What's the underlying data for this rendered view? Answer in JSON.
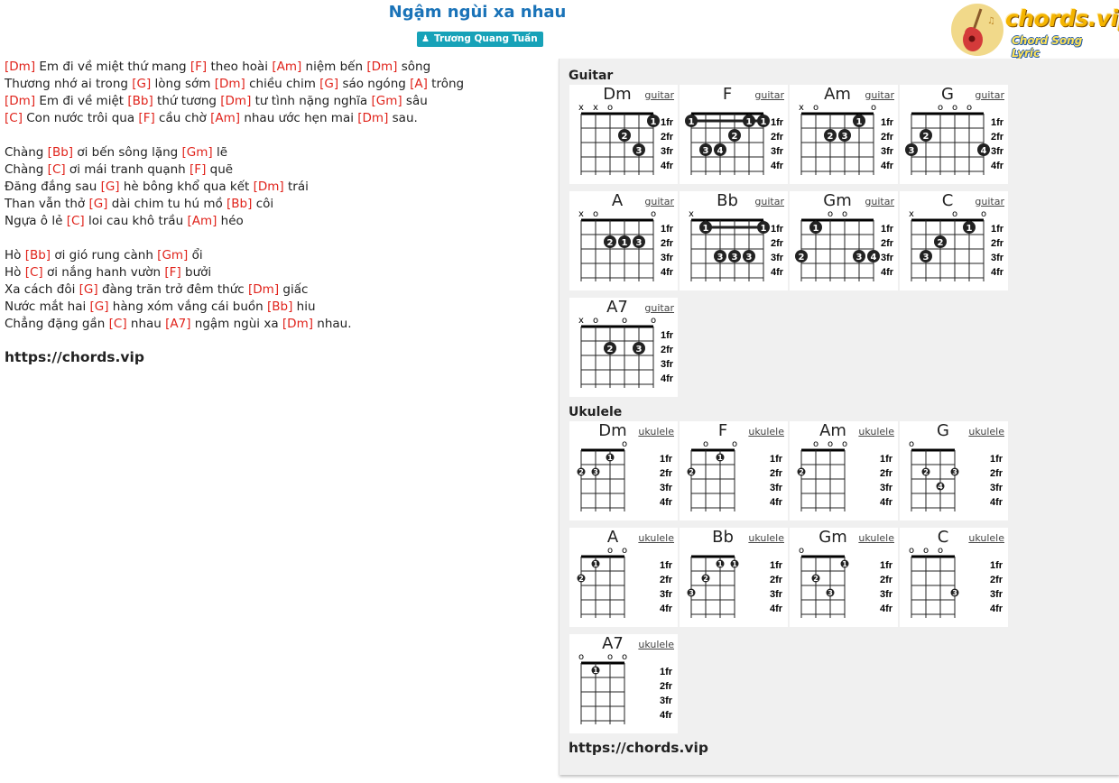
{
  "title": "Ngậm ngùi xa nhau",
  "artist": "Trương Quang Tuấn",
  "logo": {
    "text": "chords.vip",
    "subtitle": "Chord Song Lyric"
  },
  "lyrics": [
    [
      [
        "c",
        "Dm"
      ],
      [
        "t",
        " Em đi về miệt thứ mang "
      ],
      [
        "c",
        "F"
      ],
      [
        "t",
        " theo hoài "
      ],
      [
        "c",
        "Am"
      ],
      [
        "t",
        " niệm bến "
      ],
      [
        "c",
        "Dm"
      ],
      [
        "t",
        " sông"
      ]
    ],
    [
      [
        "t",
        "Thương nhớ ai trong "
      ],
      [
        "c",
        "G"
      ],
      [
        "t",
        " lòng sớm "
      ],
      [
        "c",
        "Dm"
      ],
      [
        "t",
        " chiều chim "
      ],
      [
        "c",
        "G"
      ],
      [
        "t",
        " sáo ngóng "
      ],
      [
        "c",
        "A"
      ],
      [
        "t",
        " trông"
      ]
    ],
    [
      [
        "c",
        "Dm"
      ],
      [
        "t",
        " Em đi về miệt "
      ],
      [
        "c",
        "Bb"
      ],
      [
        "t",
        " thứ tương "
      ],
      [
        "c",
        "Dm"
      ],
      [
        "t",
        " tư tình nặng nghĩa "
      ],
      [
        "c",
        "Gm"
      ],
      [
        "t",
        " sâu"
      ]
    ],
    [
      [
        "c",
        "C"
      ],
      [
        "t",
        " Con nước trôi qua "
      ],
      [
        "c",
        "F"
      ],
      [
        "t",
        " cầu chờ "
      ],
      [
        "c",
        "Am"
      ],
      [
        "t",
        " nhau ước hẹn mai "
      ],
      [
        "c",
        "Dm"
      ],
      [
        "t",
        " sau."
      ]
    ],
    [],
    [
      [
        "t",
        "Chàng "
      ],
      [
        "c",
        "Bb"
      ],
      [
        "t",
        " ơi bến sông lặng "
      ],
      [
        "c",
        "Gm"
      ],
      [
        "t",
        " lẽ"
      ]
    ],
    [
      [
        "t",
        "Chàng "
      ],
      [
        "c",
        "C"
      ],
      [
        "t",
        " ơi mái tranh quạnh "
      ],
      [
        "c",
        "F"
      ],
      [
        "t",
        " quẽ"
      ]
    ],
    [
      [
        "t",
        "Đăng đắng sau "
      ],
      [
        "c",
        "G"
      ],
      [
        "t",
        " hè bông khổ qua kết "
      ],
      [
        "c",
        "Dm"
      ],
      [
        "t",
        " trái"
      ]
    ],
    [
      [
        "t",
        "Than vẫn thở "
      ],
      [
        "c",
        "G"
      ],
      [
        "t",
        " dài chim tu hú mồ "
      ],
      [
        "c",
        "Bb"
      ],
      [
        "t",
        " côi"
      ]
    ],
    [
      [
        "t",
        "Ngựa ô lẻ "
      ],
      [
        "c",
        "C"
      ],
      [
        "t",
        " loi cau khô trầu "
      ],
      [
        "c",
        "Am"
      ],
      [
        "t",
        " héo"
      ]
    ],
    [],
    [
      [
        "t",
        "Hò "
      ],
      [
        "c",
        "Bb"
      ],
      [
        "t",
        " ơi gió rung cành "
      ],
      [
        "c",
        "Gm"
      ],
      [
        "t",
        " ổi"
      ]
    ],
    [
      [
        "t",
        "Hò "
      ],
      [
        "c",
        "C"
      ],
      [
        "t",
        " ơi nắng hanh vườn "
      ],
      [
        "c",
        "F"
      ],
      [
        "t",
        " bưởi"
      ]
    ],
    [
      [
        "t",
        "Xa cách đôi "
      ],
      [
        "c",
        "G"
      ],
      [
        "t",
        " đàng trăn trở đêm thức "
      ],
      [
        "c",
        "Dm"
      ],
      [
        "t",
        " giấc"
      ]
    ],
    [
      [
        "t",
        "Nước mắt hai "
      ],
      [
        "c",
        "G"
      ],
      [
        "t",
        " hàng xóm vắng cái buồn "
      ],
      [
        "c",
        "Bb"
      ],
      [
        "t",
        " hiu"
      ]
    ],
    [
      [
        "t",
        "Chẳng đặng gần "
      ],
      [
        "c",
        "C"
      ],
      [
        "t",
        " nhau "
      ],
      [
        "c",
        "A7"
      ],
      [
        "t",
        " ngậm ngùi xa "
      ],
      [
        "c",
        "Dm"
      ],
      [
        "t",
        " nhau."
      ]
    ]
  ],
  "site_link": "https://chords.vip",
  "panel": {
    "guitar_label": "Guitar",
    "ukulele_label": "Ukulele",
    "site_link": "https://chords.vip",
    "fret_labels": [
      "1fr",
      "2fr",
      "3fr",
      "4fr"
    ]
  },
  "guitar_chords": [
    {
      "name": "Dm",
      "type": "guitar",
      "top": [
        "x",
        "x",
        "o",
        "",
        "",
        ""
      ],
      "dots": [
        [
          6,
          1,
          "1"
        ],
        [
          4,
          2,
          "2"
        ],
        [
          5,
          3,
          "3"
        ]
      ],
      "barre": []
    },
    {
      "name": "F",
      "type": "guitar",
      "top": [
        "",
        "",
        "",
        "",
        "",
        ""
      ],
      "dots": [
        [
          1,
          1,
          "1"
        ],
        [
          5,
          1,
          "1"
        ],
        [
          6,
          1,
          "1"
        ],
        [
          4,
          2,
          "2"
        ],
        [
          2,
          3,
          "3"
        ],
        [
          3,
          3,
          "4"
        ]
      ],
      "barre": [
        1,
        1,
        6
      ]
    },
    {
      "name": "Am",
      "type": "guitar",
      "top": [
        "x",
        "o",
        "",
        "",
        "",
        "o"
      ],
      "dots": [
        [
          5,
          1,
          "1"
        ],
        [
          3,
          2,
          "2"
        ],
        [
          4,
          2,
          "3"
        ]
      ],
      "barre": []
    },
    {
      "name": "G",
      "type": "guitar",
      "top": [
        "",
        "",
        "o",
        "o",
        "o",
        ""
      ],
      "dots": [
        [
          2,
          2,
          "2"
        ],
        [
          1,
          3,
          "3"
        ],
        [
          6,
          3,
          "4"
        ]
      ],
      "barre": []
    },
    {
      "name": "A",
      "type": "guitar",
      "top": [
        "x",
        "o",
        "",
        "",
        "",
        "o"
      ],
      "dots": [
        [
          3,
          2,
          "2"
        ],
        [
          4,
          2,
          "1"
        ],
        [
          5,
          2,
          "3"
        ]
      ],
      "barre": []
    },
    {
      "name": "Bb",
      "type": "guitar",
      "top": [
        "x",
        "",
        "",
        "",
        "",
        ""
      ],
      "dots": [
        [
          2,
          1,
          "1"
        ],
        [
          6,
          1,
          "1"
        ],
        [
          3,
          3,
          "3"
        ],
        [
          4,
          3,
          "3"
        ],
        [
          5,
          3,
          "3"
        ]
      ],
      "barre": [
        1,
        2,
        6
      ]
    },
    {
      "name": "Gm",
      "type": "guitar",
      "top": [
        "",
        "",
        "o",
        "o",
        "",
        ""
      ],
      "dots": [
        [
          2,
          1,
          "1"
        ],
        [
          1,
          3,
          "2"
        ],
        [
          5,
          3,
          "3"
        ],
        [
          6,
          3,
          "4"
        ]
      ],
      "barre": []
    },
    {
      "name": "C",
      "type": "guitar",
      "top": [
        "x",
        "",
        "",
        "o",
        "",
        "o"
      ],
      "dots": [
        [
          5,
          1,
          "1"
        ],
        [
          3,
          2,
          "2"
        ],
        [
          2,
          3,
          "3"
        ]
      ],
      "barre": []
    },
    {
      "name": "A7",
      "type": "guitar",
      "top": [
        "x",
        "o",
        "",
        "o",
        "",
        "o"
      ],
      "dots": [
        [
          3,
          2,
          "2"
        ],
        [
          5,
          2,
          "3"
        ]
      ],
      "barre": []
    }
  ],
  "ukulele_chords": [
    {
      "name": "Dm",
      "type": "ukulele",
      "top": [
        "",
        "",
        "",
        "o"
      ],
      "dots": [
        [
          1,
          2,
          "2"
        ],
        [
          2,
          2,
          "3"
        ],
        [
          3,
          1,
          "1"
        ]
      ],
      "barre": []
    },
    {
      "name": "F",
      "type": "ukulele",
      "top": [
        "",
        "o",
        "",
        "o"
      ],
      "dots": [
        [
          1,
          2,
          "2"
        ],
        [
          3,
          1,
          "1"
        ]
      ],
      "barre": []
    },
    {
      "name": "Am",
      "type": "ukulele",
      "top": [
        "",
        "o",
        "o",
        "o"
      ],
      "dots": [
        [
          1,
          2,
          "2"
        ]
      ],
      "barre": []
    },
    {
      "name": "G",
      "type": "ukulele",
      "top": [
        "o",
        "",
        "",
        ""
      ],
      "dots": [
        [
          2,
          2,
          "2"
        ],
        [
          4,
          2,
          "3"
        ],
        [
          3,
          3,
          "4"
        ]
      ],
      "barre": []
    },
    {
      "name": "A",
      "type": "ukulele",
      "top": [
        "",
        "",
        "o",
        "o"
      ],
      "dots": [
        [
          1,
          2,
          "2"
        ],
        [
          2,
          1,
          "1"
        ]
      ],
      "barre": []
    },
    {
      "name": "Bb",
      "type": "ukulele",
      "top": [
        "",
        "",
        "",
        ""
      ],
      "dots": [
        [
          1,
          3,
          "3"
        ],
        [
          2,
          2,
          "2"
        ],
        [
          3,
          1,
          "1"
        ],
        [
          4,
          1,
          "1"
        ]
      ],
      "barre": []
    },
    {
      "name": "Gm",
      "type": "ukulele",
      "top": [
        "o",
        "",
        "",
        ""
      ],
      "dots": [
        [
          2,
          2,
          "2"
        ],
        [
          3,
          3,
          "3"
        ],
        [
          4,
          1,
          "1"
        ]
      ],
      "barre": []
    },
    {
      "name": "C",
      "type": "ukulele",
      "top": [
        "o",
        "o",
        "o",
        ""
      ],
      "dots": [
        [
          4,
          3,
          "3"
        ]
      ],
      "barre": []
    },
    {
      "name": "A7",
      "type": "ukulele",
      "top": [
        "o",
        "",
        "o",
        "o"
      ],
      "dots": [
        [
          2,
          1,
          "1"
        ]
      ],
      "barre": []
    }
  ]
}
